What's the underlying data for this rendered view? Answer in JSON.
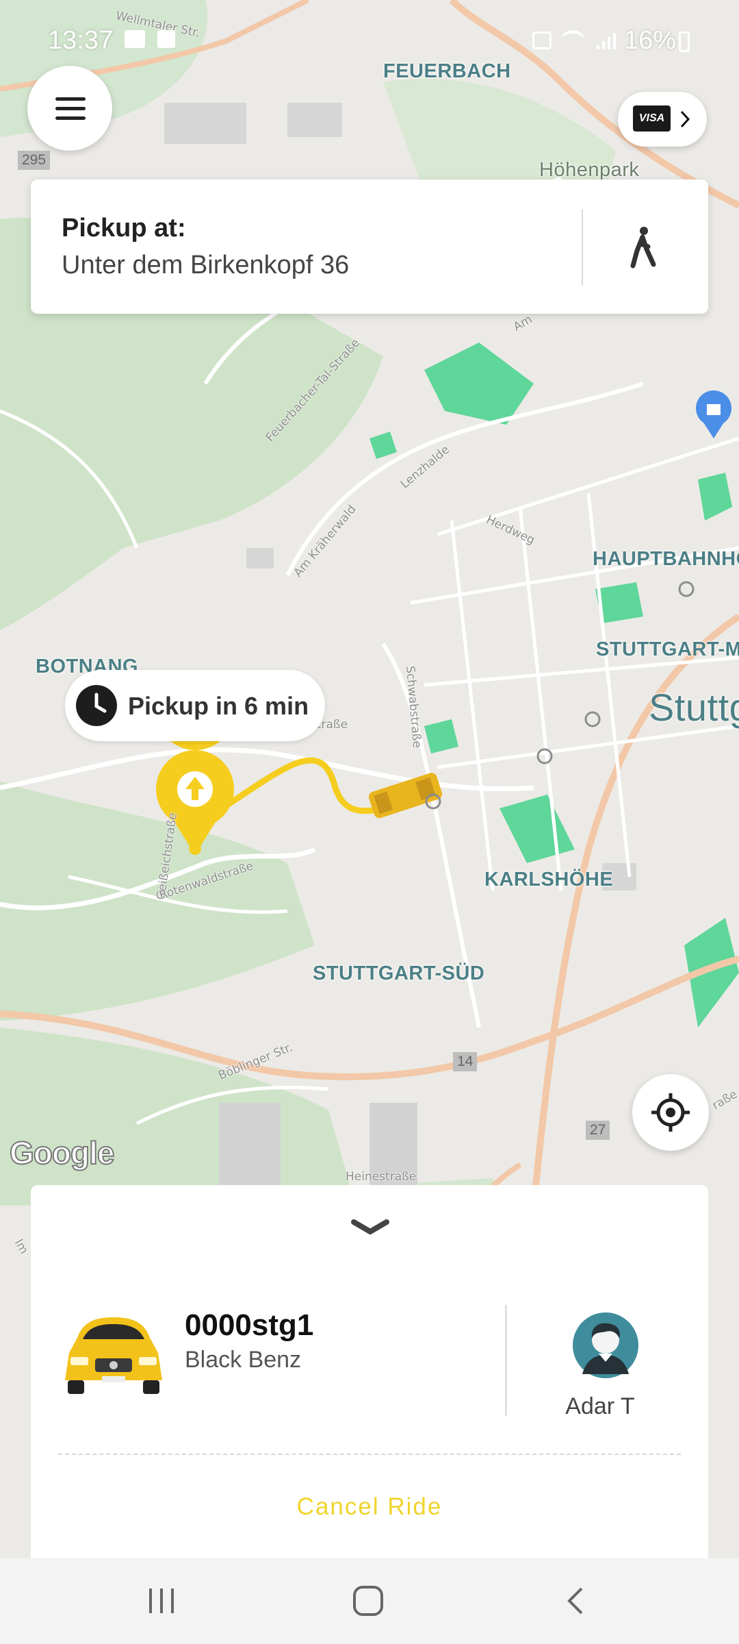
{
  "status_bar": {
    "time": "13:37",
    "battery": "16%",
    "icons": [
      "gallery-icon",
      "check-icon",
      "mute-icon",
      "wifi-icon",
      "signal-icon",
      "battery-icon"
    ]
  },
  "map": {
    "labels": {
      "feuerbach": "FEUERBACH",
      "hohenpark": "Höhenpark",
      "botnang": "BOTNANG",
      "hauptbahnhof": "HAUPTBAHNHO",
      "stuttgart_mitte": "STUTTGART-M",
      "stuttgart": "Stuttg",
      "karlshohe": "KARLSHÖHE",
      "stuttgart_sud": "STUTTGART-SÜD"
    },
    "streets": {
      "wildtaler": "Wellmtaler Str.",
      "feuerbacher": "Feuerbacher-Tal-Straße",
      "krahenwald": "Am Kräherwald",
      "lenzhalde": "Lenzhalde",
      "herdweg": "Herdweg",
      "schwab": "Schwabstraße",
      "strasse": "straße",
      "geissbach": "Geißeichstraße",
      "rotenwald": "Rotenwaldstraße",
      "boblinger": "Böblinger Str.",
      "heine": "Heinestraße",
      "am": "Am",
      "im": "Im",
      "strasse2": "raße"
    },
    "road_badges": {
      "b295": "295",
      "b14": "14",
      "b27": "27"
    },
    "attribution": "Google",
    "colors": {
      "route": "#f5cd1e",
      "park": "#5fd69a",
      "road_major": "#f2c8a8"
    }
  },
  "header": {
    "menu_icon": "hamburger-menu-icon",
    "payment_method": "VISA"
  },
  "pickup": {
    "title": "Pickup at:",
    "address": "Unter dem Birkenkopf 36",
    "walk_icon": "walking-person-icon"
  },
  "eta": {
    "text": "Pickup in 6 min"
  },
  "ride": {
    "plate": "0000stg1",
    "model": "Black Benz",
    "driver_name": "Adar T",
    "cancel_label": "Cancel Ride"
  },
  "colors": {
    "accent": "#f5cd1e",
    "cancel_text": "#f0d42a"
  }
}
